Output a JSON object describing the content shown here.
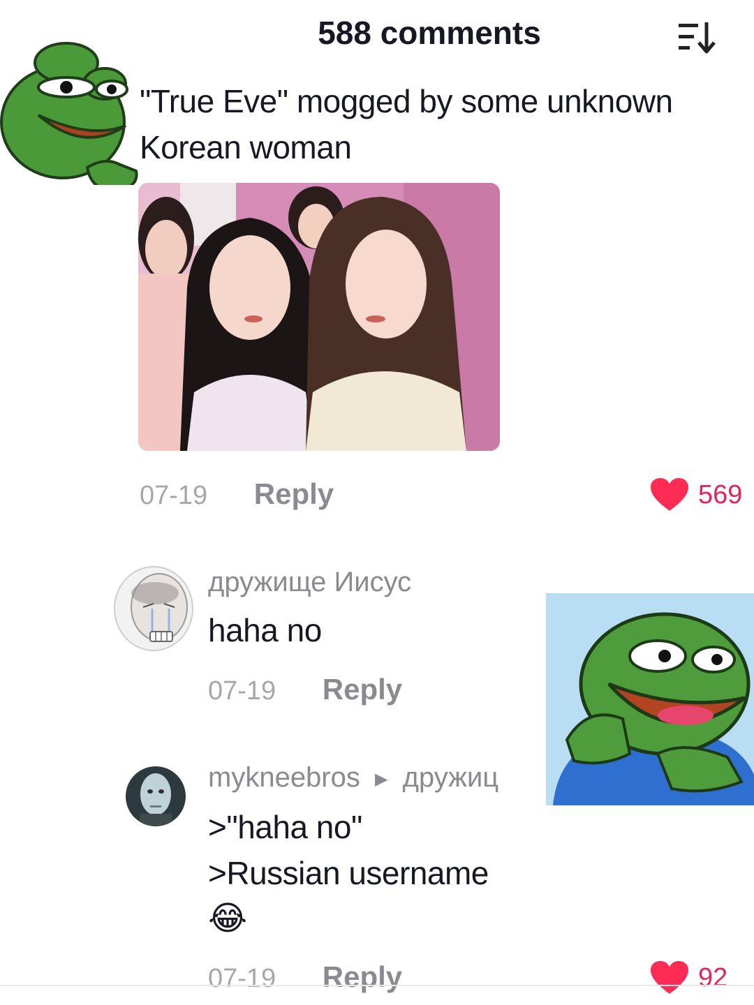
{
  "header": {
    "title": "588 comments",
    "sort_icon": "sort-descending-icon"
  },
  "main_comment": {
    "text_line1": "\"True Eve\" mogged by some unknown",
    "text_line2": "Korean woman",
    "date": "07-19",
    "reply_label": "Reply",
    "likes": "569",
    "liked": true
  },
  "replies": [
    {
      "username": "дружище Иисус",
      "text": "haha no",
      "date": "07-19",
      "reply_label": "Reply"
    },
    {
      "username": "mykneebros",
      "reply_to": "дружиц",
      "lines": [
        ">\"haha no\"",
        ">Russian username",
        "😂"
      ],
      "date": "07-19",
      "reply_label": "Reply",
      "likes": "92"
    }
  ],
  "colors": {
    "like_red": "#fe2c55",
    "like_count": "#e0265a",
    "meta_gray": "#8a8b91",
    "text": "#161823"
  }
}
